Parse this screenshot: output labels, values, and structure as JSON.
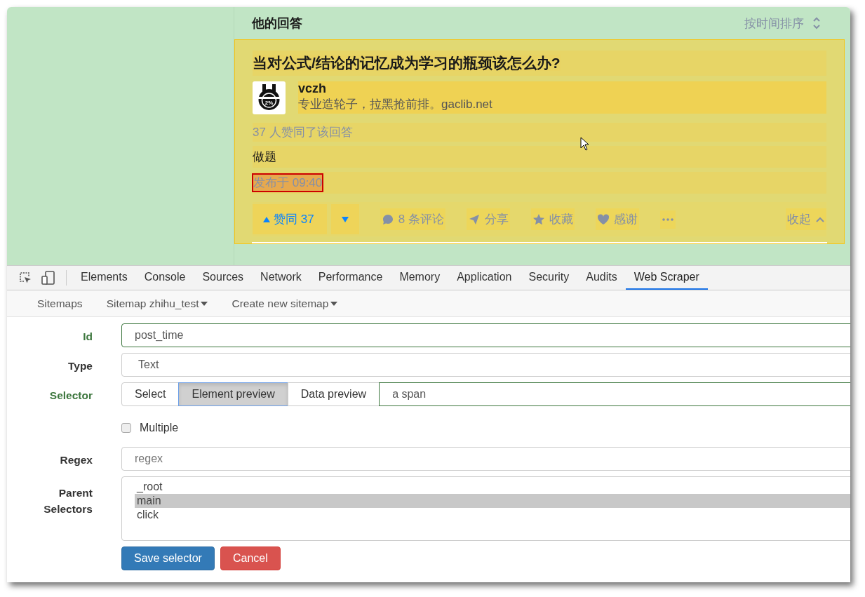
{
  "page": {
    "section_title": "他的回答",
    "sort_label": "按时间排序",
    "answer": {
      "question": "当对公式/结论的记忆成为学习的瓶颈该怎么办?",
      "author": {
        "avatar_text": "2%",
        "name": "vczh",
        "headline": "专业造轮子，拉黑抢前排。gaclib.net"
      },
      "votes_summary": "37 人赞同了该回答",
      "content": "做题",
      "post_time": {
        "text": "发布于 09:40",
        "selected": true
      },
      "actions": {
        "upvote": "赞同 37",
        "comments": "8 条评论",
        "share": "分享",
        "favorite": "收藏",
        "thanks": "感谢",
        "collapse": "收起"
      }
    }
  },
  "devtools": {
    "tabs": [
      {
        "label": "Elements",
        "selected": false
      },
      {
        "label": "Console",
        "selected": false
      },
      {
        "label": "Sources",
        "selected": false
      },
      {
        "label": "Network",
        "selected": false
      },
      {
        "label": "Performance",
        "selected": false
      },
      {
        "label": "Memory",
        "selected": false
      },
      {
        "label": "Application",
        "selected": false
      },
      {
        "label": "Security",
        "selected": false
      },
      {
        "label": "Audits",
        "selected": false
      },
      {
        "label": "Web Scraper",
        "selected": true
      }
    ],
    "subnav": [
      {
        "label": "Sitemaps",
        "dropdown": false
      },
      {
        "label": "Sitemap zhihu_test",
        "dropdown": true
      },
      {
        "label": "Create new sitemap",
        "dropdown": true
      }
    ],
    "form": {
      "id": {
        "label": "Id",
        "value": "post_time",
        "validated": true
      },
      "type": {
        "label": "Type",
        "value": "Text",
        "validated": false
      },
      "selector": {
        "label": "Selector",
        "validated": true,
        "value": "a span",
        "buttons": [
          {
            "label": "Select",
            "selected": false
          },
          {
            "label": "Element preview",
            "selected": true
          },
          {
            "label": "Data preview",
            "selected": false
          }
        ]
      },
      "multiple": {
        "label": "Multiple",
        "checked": false
      },
      "regex": {
        "label": "Regex",
        "placeholder": "regex",
        "validated": false
      },
      "parent_selectors": {
        "label": "Parent Selectors",
        "validated": false,
        "options": [
          {
            "label": "_root",
            "selected": false
          },
          {
            "label": "main",
            "selected": true
          },
          {
            "label": "click",
            "selected": false
          }
        ]
      },
      "buttons": {
        "save": "Save selector",
        "cancel": "Cancel"
      }
    }
  }
}
